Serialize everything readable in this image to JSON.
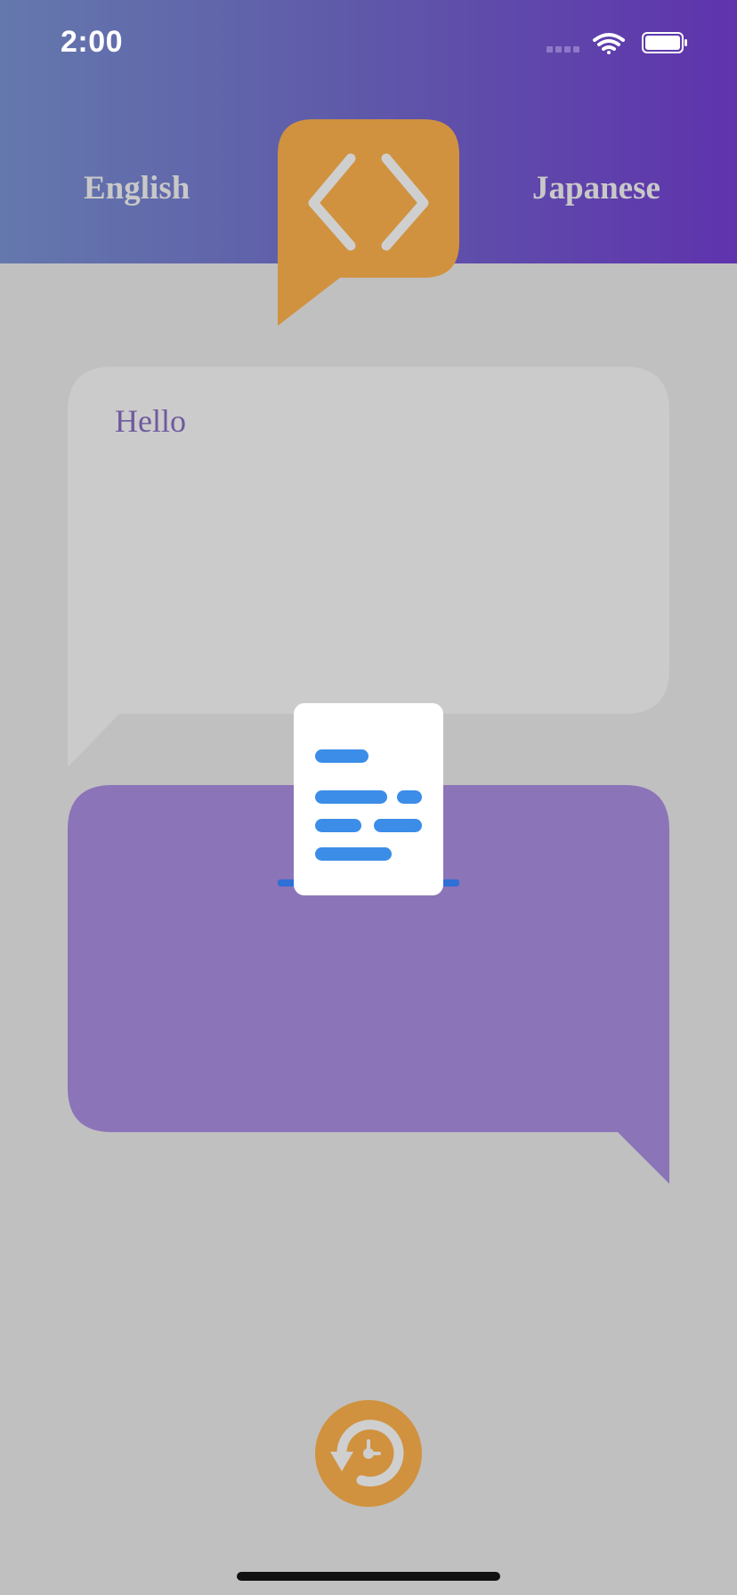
{
  "status_bar": {
    "time": "2:00",
    "signal_icon": "signal-dots-icon",
    "wifi_icon": "wifi-icon",
    "battery_icon": "battery-icon"
  },
  "header": {
    "source_language": "English",
    "target_language": "Japanese",
    "swap_icon": "chevrons-left-right-icon"
  },
  "source_bubble": {
    "text": "Hello"
  },
  "target_bubble": {
    "text": ""
  },
  "translate_icon": "document-icon",
  "reset_icon": "rotate-reset-icon",
  "colors": {
    "header_gradient_start": "#6478ad",
    "header_gradient_end": "#5f33ad",
    "accent_orange": "#d0923f",
    "source_bubble": "#cbcbcb",
    "target_bubble": "#8c74b8",
    "background": "#c0c0c0",
    "document_lines": "#3b8de8"
  }
}
